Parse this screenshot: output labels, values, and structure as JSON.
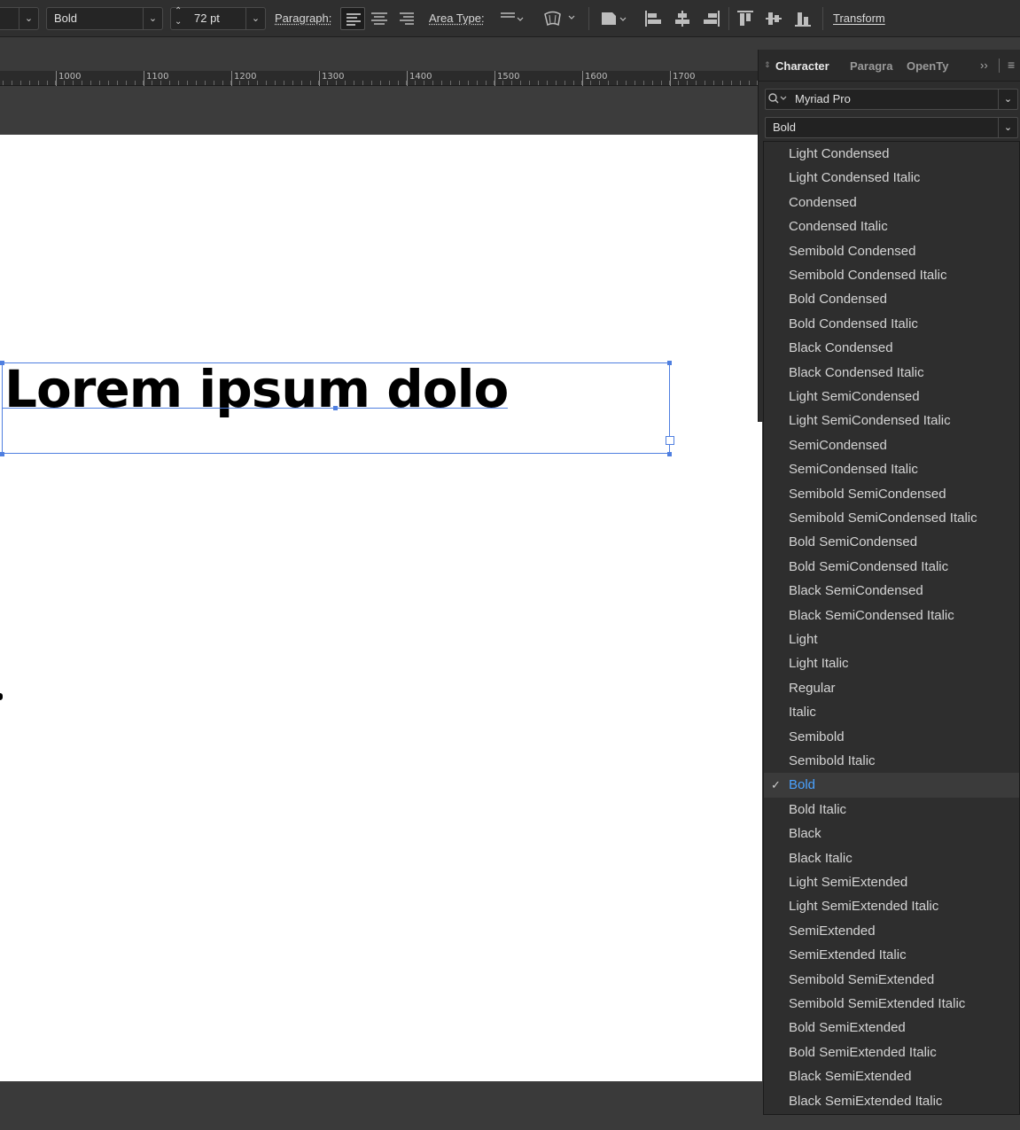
{
  "controlbar": {
    "font_style": "Bold",
    "font_size": "72 pt",
    "paragraph_label": "Paragraph:",
    "area_type_label": "Area Type:",
    "transform_label": "Transform"
  },
  "ruler": {
    "labels": [
      "1000",
      "1100",
      "1200",
      "1300",
      "1400",
      "1500",
      "1600",
      "1700"
    ]
  },
  "canvas": {
    "text": "Lorem ipsum dolo"
  },
  "panel": {
    "tabs": [
      "Character",
      "Paragra",
      "OpenTy"
    ],
    "font_family": "Myriad Pro",
    "font_style": "Bold"
  },
  "dropdown": {
    "selected": "Bold",
    "options": [
      "Light Condensed",
      "Light Condensed Italic",
      "Condensed",
      "Condensed Italic",
      "Semibold Condensed",
      "Semibold Condensed Italic",
      "Bold Condensed",
      "Bold Condensed Italic",
      "Black Condensed",
      "Black Condensed Italic",
      "Light SemiCondensed",
      "Light SemiCondensed Italic",
      "SemiCondensed",
      "SemiCondensed Italic",
      "Semibold SemiCondensed",
      "Semibold SemiCondensed Italic",
      "Bold SemiCondensed",
      "Bold SemiCondensed Italic",
      "Black SemiCondensed",
      "Black SemiCondensed Italic",
      "Light",
      "Light Italic",
      "Regular",
      "Italic",
      "Semibold",
      "Semibold Italic",
      "Bold",
      "Bold Italic",
      "Black",
      "Black Italic",
      "Light SemiExtended",
      "Light SemiExtended Italic",
      "SemiExtended",
      "SemiExtended Italic",
      "Semibold SemiExtended",
      "Semibold SemiExtended Italic",
      "Bold SemiExtended",
      "Bold SemiExtended Italic",
      "Black SemiExtended",
      "Black SemiExtended Italic"
    ]
  },
  "colors": {
    "accent": "#4aa2ff",
    "selection": "#4f7fe0",
    "panel_bg": "#2e2e2e"
  }
}
